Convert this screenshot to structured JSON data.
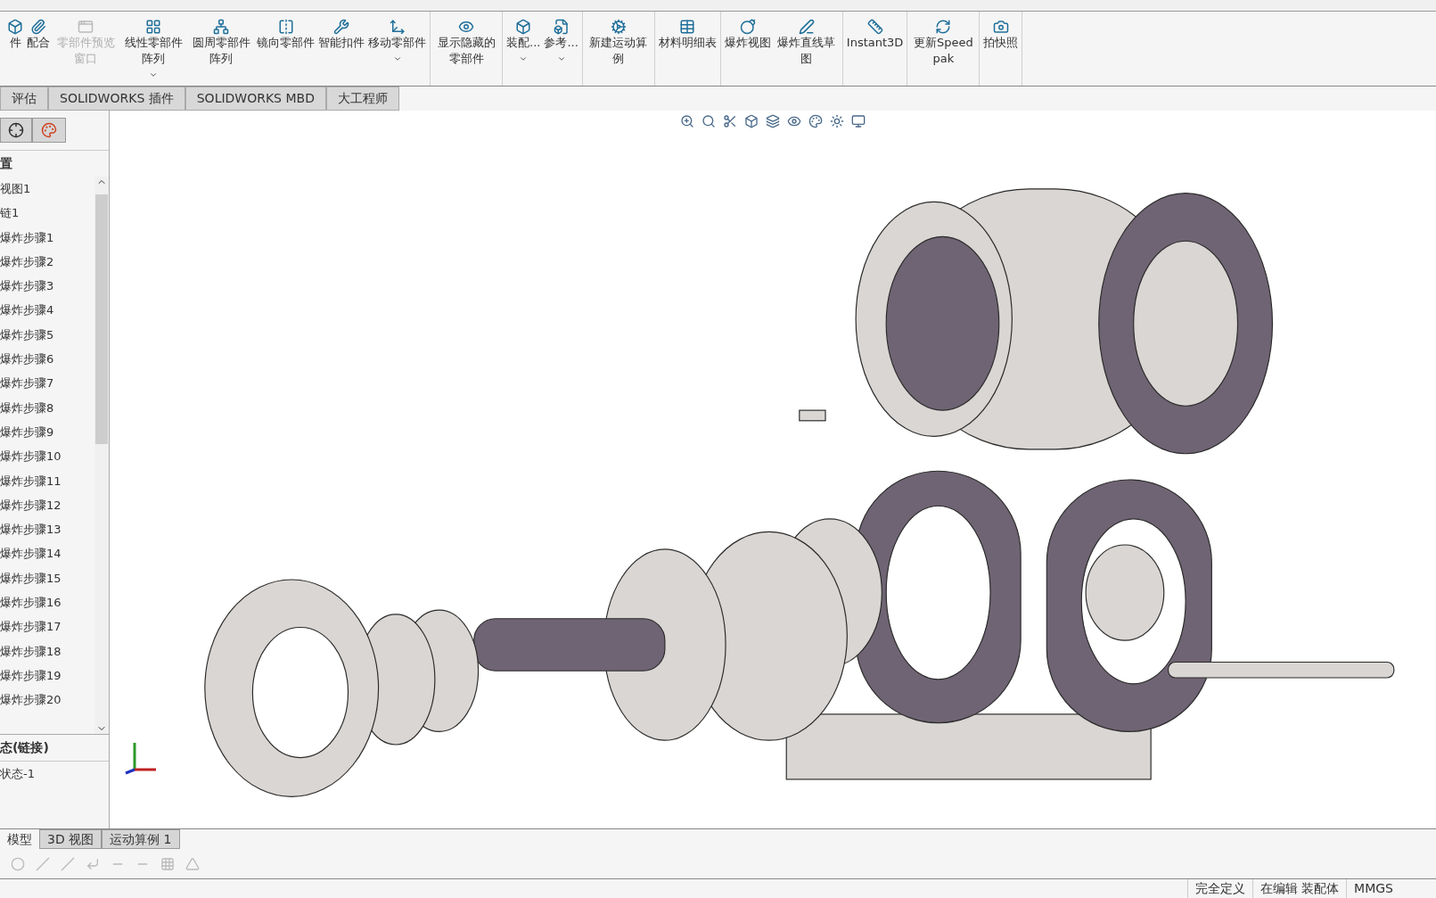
{
  "ribbon": {
    "groups": [
      [
        {
          "label": "件",
          "disabled": false,
          "dropdown": false
        },
        {
          "label": "配合",
          "disabled": false,
          "dropdown": false
        },
        {
          "label": "零部件预览窗口",
          "disabled": true,
          "dropdown": false
        },
        {
          "label": "线性零部件阵列",
          "disabled": false,
          "dropdown": true
        },
        {
          "label": "圆周零部件阵列",
          "disabled": false,
          "dropdown": false
        },
        {
          "label": "镜向零部件",
          "disabled": false,
          "dropdown": false
        },
        {
          "label": "智能扣件",
          "disabled": false,
          "dropdown": false
        },
        {
          "label": "移动零部件",
          "disabled": false,
          "dropdown": true
        }
      ],
      [
        {
          "label": "显示隐藏的零部件",
          "disabled": false,
          "dropdown": false
        }
      ],
      [
        {
          "label": "装配...",
          "disabled": false,
          "dropdown": true
        },
        {
          "label": "参考...",
          "disabled": false,
          "dropdown": true
        }
      ],
      [
        {
          "label": "新建运动算例",
          "disabled": false,
          "dropdown": false
        }
      ],
      [
        {
          "label": "材料明细表",
          "disabled": false,
          "dropdown": false
        }
      ],
      [
        {
          "label": "爆炸视图",
          "disabled": false,
          "dropdown": false
        },
        {
          "label": "爆炸直线草图",
          "disabled": false,
          "dropdown": false
        }
      ],
      [
        {
          "label": "Instant3D",
          "disabled": false,
          "dropdown": false
        }
      ],
      [
        {
          "label": "更新Speedpak",
          "disabled": false,
          "dropdown": false
        }
      ],
      [
        {
          "label": "拍快照",
          "disabled": false,
          "dropdown": false
        }
      ]
    ]
  },
  "command_tabs": [
    {
      "label": "评估",
      "selected": false
    },
    {
      "label": "SOLIDWORKS 插件",
      "selected": false
    },
    {
      "label": "SOLIDWORKS MBD",
      "selected": false
    },
    {
      "label": "大工程师",
      "selected": false
    }
  ],
  "tree": {
    "heading": "置",
    "items": [
      "视图1",
      "链1",
      "爆炸步骤1",
      "爆炸步骤2",
      "爆炸步骤3",
      "爆炸步骤4",
      "爆炸步骤5",
      "爆炸步骤6",
      "爆炸步骤7",
      "爆炸步骤8",
      "爆炸步骤9",
      "爆炸步骤10",
      "爆炸步骤11",
      "爆炸步骤12",
      "爆炸步骤13",
      "爆炸步骤14",
      "爆炸步骤15",
      "爆炸步骤16",
      "爆炸步骤17",
      "爆炸步骤18",
      "爆炸步骤19",
      "爆炸步骤20"
    ],
    "state_heading": "态(链接)",
    "state_item": "状态-1"
  },
  "bottom_tabs": [
    {
      "label": "模型",
      "selected": true
    },
    {
      "label": "3D 视图",
      "selected": false
    },
    {
      "label": "运动算例 1",
      "selected": false
    }
  ],
  "status_bar": [
    "完全定义",
    "在编辑 装配体",
    "MMGS"
  ]
}
